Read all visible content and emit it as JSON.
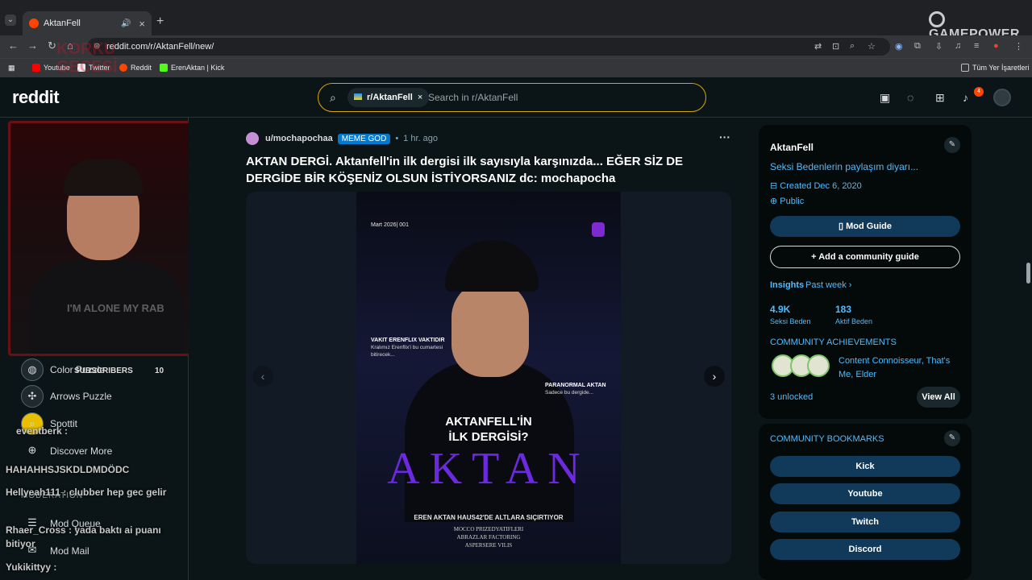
{
  "browser": {
    "tab_title": "AktanFell",
    "url": "reddit.com/r/AktanFell/new/",
    "bookmarks": [
      {
        "label": "Youtube",
        "color": "#ff0000"
      },
      {
        "label": "Twitter",
        "color": "#e8eaed"
      },
      {
        "label": "Reddit",
        "color": "#ff4500"
      },
      {
        "label": "ErenAktan | Kick",
        "color": "#53fc18"
      }
    ],
    "all_bookmarks": "Tüm Yer İşaretleri",
    "overlay_brand": "GAMEPOWER"
  },
  "header": {
    "logo": "reddit",
    "search_chip": "r/AktanFell",
    "search_placeholder": "Search in r/AktanFell",
    "notification_count": "4"
  },
  "left_sidebar": {
    "items": [
      {
        "label": "Color Puzzle",
        "icon": "puzzle-icon"
      },
      {
        "label": "Arrows Puzzle",
        "icon": "arrows-icon"
      },
      {
        "label": "Spottit",
        "icon": "magnifier-icon"
      },
      {
        "label": "Discover More",
        "icon": "gamepad-icon"
      }
    ],
    "moderation_header": "MODERATION",
    "mod_items": [
      {
        "label": "Mod Queue",
        "icon": "queue-icon"
      },
      {
        "label": "Mod Mail",
        "icon": "mail-icon"
      }
    ],
    "stream_overlay": {
      "subscribers_label": "SUBSCRIBERS",
      "subscribers_count": "10",
      "shirt_text": "I'M ALONE MY RAB"
    },
    "chat_messages": [
      "eventberk :",
      "HAHAHHSJSKDLDMDÖDC",
      "Hellyeah111 : clubber hep gec gelir",
      "Rhaer_Cross : yada baktı ai puanı bitiyor",
      "Yukikittyy :"
    ]
  },
  "post": {
    "author": "u/mochapochaa",
    "flair": "MEME GOD",
    "time": "1 hr. ago",
    "title": "AKTAN DERGİ. Aktanfell'in ilk dergisi ilk sayısıyla karşınızda... EĞER SİZ DE DERGİDE BİR KÖŞENİZ OLSUN İSTİYORSANIZ dc: mochapocha",
    "magazine": {
      "issue": "Mart 2026| 001",
      "left_block_title": "VAKIT ERENFLIX VAKTIDIR",
      "left_block_text": "Kralımız Erenflix'i bu cumartesi bitirecek...",
      "right_block_title": "PARANORMAL AKTAN",
      "right_block_text": "Sadece bu dergide...",
      "headline_1": "AKTANFELL'İN",
      "headline_2": "İLK DERGİSİ?",
      "big_title": "AKTAN",
      "tagline": "EREN AKTAN HAUS42'DE ALTLARA SIÇIRTIYOR",
      "list_1": "MOCCO PRIZEDYATIFLERI",
      "list_2": "ABRAZLAR FACTORING",
      "list_3": "ASPERSERE VILIS"
    }
  },
  "right_sidebar": {
    "community_name": "AktanFell",
    "description": "Seksi Bedenlerin paylaşım diyarı...",
    "created": "Created Dec 6, 2020",
    "visibility": "Public",
    "mod_guide": "Mod Guide",
    "add_guide": "Add a community guide",
    "insights_label": "Insights",
    "insights_period": "Past week",
    "stats": [
      {
        "value": "4.9K",
        "label": "Seksi Beden"
      },
      {
        "value": "183",
        "label": "Aktif Beden"
      }
    ],
    "achievements_header": "COMMUNITY ACHIEVEMENTS",
    "achievements_text": "Content Connoisseur, That's Me, Elder",
    "unlocked": "3 unlocked",
    "view_all": "View All",
    "bookmarks_header": "COMMUNITY BOOKMARKS",
    "bookmarks": [
      "Kick",
      "Youtube",
      "Twitch",
      "Discord"
    ]
  },
  "colors": {
    "accent": "#0079d3",
    "brand": "#ff4500",
    "link": "#4fbcff",
    "magazine_title": "#6c2ae0"
  }
}
